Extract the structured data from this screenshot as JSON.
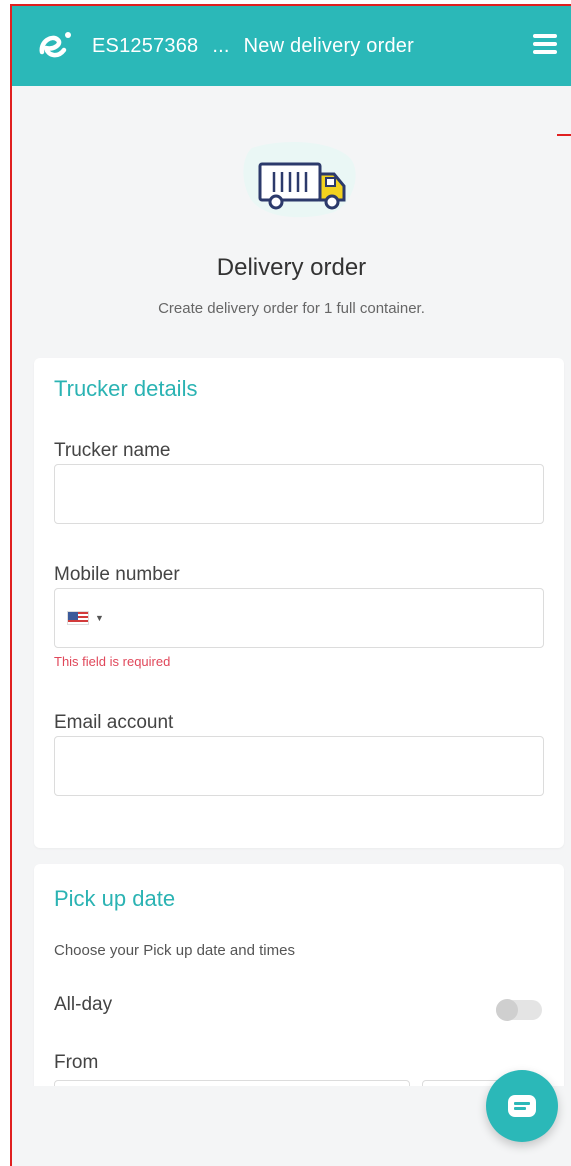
{
  "header": {
    "order_id": "ES1257368",
    "ellipsis": "...",
    "page_title": "New delivery order"
  },
  "hero": {
    "title": "Delivery order",
    "subtitle": "Create delivery order for 1 full container."
  },
  "trucker_details": {
    "title": "Trucker details",
    "trucker_name_label": "Trucker name",
    "trucker_name_value": "",
    "mobile_label": "Mobile number",
    "mobile_value": "",
    "mobile_error": "This field is required",
    "email_label": "Email account",
    "email_value": ""
  },
  "pickup": {
    "title": "Pick up date",
    "hint": "Choose your Pick up date and times",
    "all_day_label": "All-day",
    "all_day_on": false,
    "from_label": "From"
  },
  "colors": {
    "brand": "#2bb8b8",
    "error": "#e0475a",
    "frame_outline": "#e02020"
  },
  "icons": [
    "logo-icon",
    "menu-icon",
    "truck-icon",
    "us-flag-icon",
    "caret-down-icon",
    "chat-icon"
  ]
}
